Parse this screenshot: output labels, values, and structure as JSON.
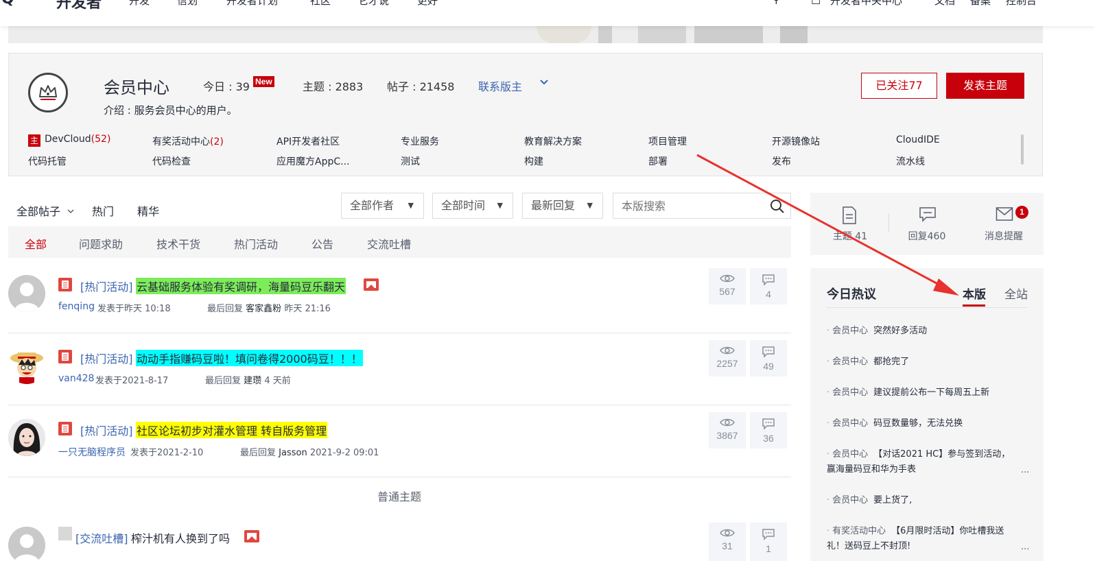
{
  "topnav": {
    "left_glyph": "Q",
    "logo": "开发者",
    "items": [
      "开发",
      "信划",
      "开发者计划",
      "社区",
      "它才说",
      "更好"
    ],
    "right_items": [
      "开发者中关中心",
      "文档",
      "备案",
      "控制台"
    ]
  },
  "forum": {
    "title": "会员中心",
    "today_label": "今日 : 39",
    "new_badge": "New",
    "topics_label": "主题 : 2883",
    "posts_label": "帖子 : 21458",
    "contact": "联系版主",
    "intro": "介绍 : 服务会员中心的用户。",
    "follow_button": "已关注77",
    "post_button": "发表主题",
    "zhu_badge": "主",
    "subforums_row1": [
      {
        "name": "DevCloud",
        "count": "(52)"
      },
      {
        "name": "有奖活动中心",
        "count": "(2)"
      },
      {
        "name": "API开发者社区",
        "count": ""
      },
      {
        "name": "专业服务",
        "count": ""
      },
      {
        "name": "教育解决方案",
        "count": ""
      },
      {
        "name": "项目管理",
        "count": ""
      },
      {
        "name": "开源镜像站",
        "count": ""
      },
      {
        "name": "CloudIDE",
        "count": ""
      }
    ],
    "subforums_row2": [
      "代码托管",
      "代码检查",
      "应用魔方AppC...",
      "测试",
      "构建",
      "部署",
      "发布",
      "流水线"
    ]
  },
  "filters": {
    "all_posts": "全部帖子",
    "hot": "热门",
    "essence": "精华",
    "author_dropdown": "全部作者",
    "time_dropdown": "全部时间",
    "sort_dropdown": "最新回复",
    "search_placeholder": "本版搜索"
  },
  "category_tabs": [
    "全部",
    "问题求助",
    "技术干货",
    "热门活动",
    "公告",
    "交流吐槽"
  ],
  "threads": [
    {
      "category": "[热门活动]",
      "title": "云基础服务体验有奖调研，海量码豆乐翻天",
      "highlight": "#7dec5a",
      "author": "fenqing",
      "posted": "发表于昨天 10:18",
      "last_reply_label": "最后回复",
      "last_reply_user": "客家鑫粉",
      "last_reply_time": "昨天 21:16",
      "views": "567",
      "replies": "4"
    },
    {
      "category": "[热门活动]",
      "title": "动动手指赚码豆啦！填问卷得2000码豆！！！",
      "highlight": "#00ffff",
      "author": "van428",
      "posted": "发表于2021-8-17",
      "last_reply_label": "最后回复",
      "last_reply_user": "建瓒",
      "last_reply_time": "4 天前",
      "views": "2257",
      "replies": "49"
    },
    {
      "category": "[热门活动]",
      "title": "社区论坛初步对灌水管理 转自版务管理",
      "highlight": "#ffff00",
      "author": "一只无脑程序员",
      "posted": "发表于2021-2-10",
      "last_reply_label": "最后回复",
      "last_reply_user": "Jasson",
      "last_reply_time": "2021-9-2 09:01",
      "views": "3867",
      "replies": "36"
    }
  ],
  "normal_topics_label": "普通主题",
  "last_thread": {
    "category": "[交流吐槽]",
    "title": "榨汁机有人换到了吗",
    "views": "31",
    "replies": "1"
  },
  "user_stats": {
    "topics": "主题 41",
    "replies": "回复460",
    "messages": "消息提醒",
    "message_badge": "1"
  },
  "hot_today": {
    "title": "今日热议",
    "tab_board": "本版",
    "tab_site": "全站",
    "more": "...",
    "items": [
      {
        "forum": "会员中心",
        "text": "突然好多活动"
      },
      {
        "forum": "会员中心",
        "text": "都抢完了"
      },
      {
        "forum": "会员中心",
        "text": "建议提前公布一下每周五上新"
      },
      {
        "forum": "会员中心",
        "text": "码豆数量够，无法兑换"
      },
      {
        "forum": "会员中心",
        "text": "【对话2021 HC】参与签到活动，",
        "line2": "赢海量码豆和华为手表"
      },
      {
        "forum": "会员中心",
        "text": "要上货了,"
      },
      {
        "forum": "有奖活动中心",
        "text": "【6月限时活动】你吐槽我送",
        "line2": "礼！送码豆上不封顶!"
      }
    ]
  },
  "colors": {
    "brand_red": "#c7000b",
    "link_blue": "#3a64b0",
    "annotation_arrow": "#e8322d"
  }
}
